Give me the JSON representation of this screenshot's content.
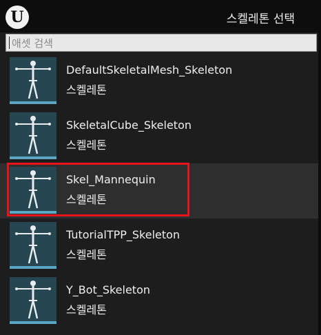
{
  "window": {
    "title": "스켈레톤 선택",
    "logo_icon": "unreal-logo-icon",
    "logo_text": "U"
  },
  "search": {
    "placeholder": "애셋 검색",
    "value": ""
  },
  "items": [
    {
      "name": "DefaultSkeletalMesh_Skeleton",
      "type": "스켈레톤",
      "selected": false
    },
    {
      "name": "SkeletalCube_Skeleton",
      "type": "스켈레톤",
      "selected": false
    },
    {
      "name": "Skel_Mannequin",
      "type": "스켈레톤",
      "selected": true
    },
    {
      "name": "TutorialTPP_Skeleton",
      "type": "스켈레톤",
      "selected": false
    },
    {
      "name": "Y_Bot_Skeleton",
      "type": "스켈레톤",
      "selected": false
    }
  ],
  "colors": {
    "highlight": "#e8141b",
    "thumb_bg": "#264752",
    "thumb_bar": "#5aa6c4"
  }
}
